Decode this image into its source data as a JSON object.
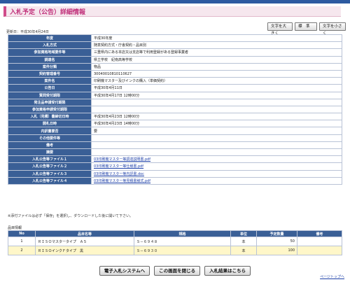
{
  "page": {
    "title": "入札予定（公告）詳細情報",
    "updated": "更新日：平成30年4月24日"
  },
  "font_buttons": [
    {
      "label": "文字を大きく"
    },
    {
      "label": "標　準"
    },
    {
      "label": "文字を小さく"
    }
  ],
  "info_rows": [
    {
      "label": "年度",
      "value": "平成30年度"
    },
    {
      "label": "入札方式",
      "value": "随意契約方式・庁舎契約・品目別"
    },
    {
      "label": "参加資格地域要件等",
      "value": "三重県内にある本店又は支店等で利用登録がある登録事業者"
    },
    {
      "label": "調達名",
      "value": "県立学校　紀南高等学校"
    },
    {
      "label": "案件分類",
      "value": "物品"
    },
    {
      "label": "契約管理番号",
      "value": "30040010810110627"
    },
    {
      "label": "案件名",
      "value": "印刷機マスター及びインクの購入（単価契約）"
    },
    {
      "label": "公告日",
      "value": "平成30年4月11日"
    },
    {
      "label": "質問受付期限",
      "value": "平成30年4月17日 12時00分"
    },
    {
      "label": "発注品申請受付期限",
      "value": ""
    },
    {
      "label": "参加資格申請受付期限",
      "value": ""
    },
    {
      "label": "入札（見積）書締切日時",
      "value": "平成30年4月23日 12時00分"
    },
    {
      "label": "開札日時",
      "value": "平成30年4月23日 14時00分"
    },
    {
      "label": "内訳書要否",
      "value": "要"
    },
    {
      "label": "その他要件等",
      "value": ""
    },
    {
      "label": "備考",
      "value": ""
    },
    {
      "label": "摘要",
      "value": ""
    },
    {
      "label": "入札公告等ファイル１",
      "value": "03印刷機マスター等調達説明書.pdf",
      "link": true
    },
    {
      "label": "入札公告等ファイル２",
      "value": "03印刷機マスター等仕様書.pdf",
      "link": true
    },
    {
      "label": "入札公告等ファイル３",
      "value": "03印刷機マスター等内訳書.doc",
      "link": true
    },
    {
      "label": "入札公告等ファイル４",
      "value": "03印刷機マスター等見積書様式.pdf",
      "link": true
    }
  ],
  "note": "※添付ファイルは必ず「保存」を選択し、ダウンロードした後に開いて下さい。",
  "items": {
    "title": "品目情報",
    "headers": [
      "No",
      "品目名等",
      "規格",
      "単位",
      "予定数量",
      "備考"
    ],
    "rows": [
      {
        "no": "1",
        "name": "ＲＩＳＯマスタータイプ　Ａ５",
        "spec": "Ｓ－６９４８",
        "unit": "本",
        "qty": "50",
        "remarks": ""
      },
      {
        "no": "2",
        "name": "ＲＩＳＯインクＦタイプ　黒",
        "spec": "Ｓ－６９３０",
        "unit": "本",
        "qty": "100",
        "remarks": ""
      }
    ]
  },
  "actions": [
    {
      "label": "電子入札システムへ"
    },
    {
      "label": "この画面を閉じる"
    },
    {
      "label": "入札結果はこちら"
    }
  ],
  "page_top": "ページトップへ"
}
